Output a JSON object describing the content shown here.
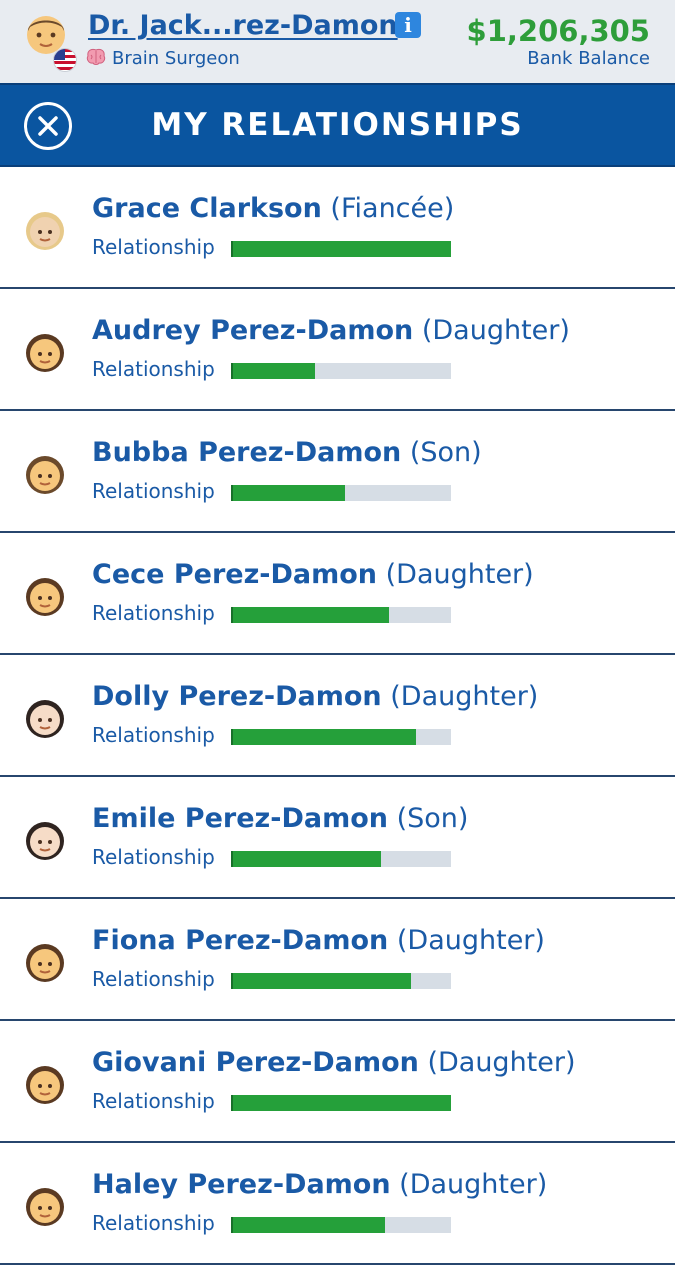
{
  "header": {
    "player_name": "Dr. Jack...rez-Damon",
    "occupation": "Brain Surgeon",
    "bank_balance": "$1,206,305",
    "bank_label": "Bank Balance"
  },
  "titlebar": {
    "title": "MY RELATIONSHIPS"
  },
  "relationship_label": "Relationship",
  "people": [
    {
      "name": "Grace Clarkson",
      "relation": "(Fiancée)",
      "level": 1.0,
      "skin": "#f0d2b0",
      "hair": "#e7c98a"
    },
    {
      "name": "Audrey Perez-Damon",
      "relation": "(Daughter)",
      "level": 0.38,
      "skin": "#f6c77d",
      "hair": "#5a3a22"
    },
    {
      "name": "Bubba Perez-Damon",
      "relation": "(Son)",
      "level": 0.52,
      "skin": "#f6c77d",
      "hair": "#6b4a2b"
    },
    {
      "name": "Cece Perez-Damon",
      "relation": "(Daughter)",
      "level": 0.72,
      "skin": "#f6c77d",
      "hair": "#5a3a22"
    },
    {
      "name": "Dolly Perez-Damon",
      "relation": "(Daughter)",
      "level": 0.84,
      "skin": "#f6dcc7",
      "hair": "#2f2420"
    },
    {
      "name": "Emile Perez-Damon",
      "relation": "(Son)",
      "level": 0.68,
      "skin": "#f6dcc7",
      "hair": "#2f2420"
    },
    {
      "name": "Fiona Perez-Damon",
      "relation": "(Daughter)",
      "level": 0.82,
      "skin": "#f6c77d",
      "hair": "#5a3a22"
    },
    {
      "name": "Giovani Perez-Damon",
      "relation": "(Daughter)",
      "level": 1.0,
      "skin": "#f6c77d",
      "hair": "#5a3a22"
    },
    {
      "name": "Haley Perez-Damon",
      "relation": "(Daughter)",
      "level": 0.7,
      "skin": "#f6c77d",
      "hair": "#5a3a22"
    }
  ],
  "colors": {
    "accent": "#0a55a0",
    "bar_fill": "#25a03a",
    "bar_track": "#d6dde5",
    "money": "#2e9e3a"
  }
}
